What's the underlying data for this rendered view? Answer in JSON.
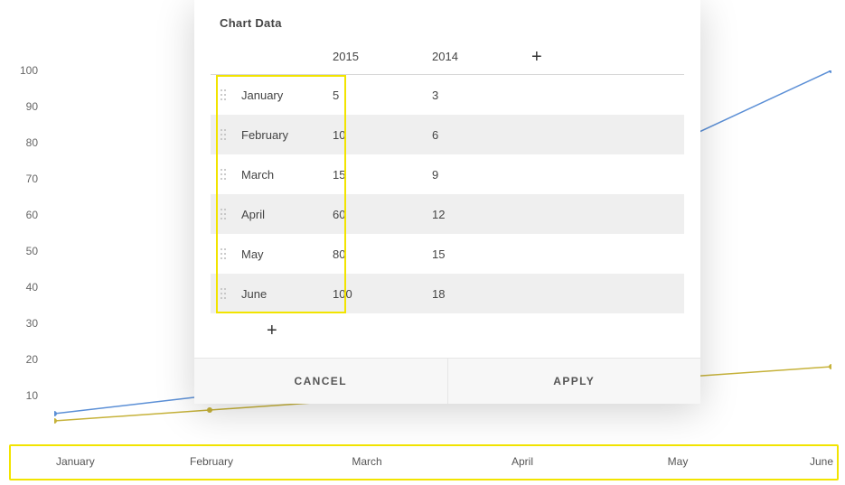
{
  "dialog": {
    "title": "Chart Data",
    "series_headers": [
      "2015",
      "2014"
    ],
    "rows": [
      "January",
      "February",
      "March",
      "April",
      "May",
      "June"
    ],
    "cells": {
      "2015": [
        5,
        10,
        15,
        60,
        80,
        100
      ],
      "2014": [
        3,
        6,
        9,
        12,
        15,
        18
      ]
    },
    "add_series_label": "+",
    "add_row_label": "+",
    "cancel_label": "CANCEL",
    "apply_label": "APPLY"
  },
  "axes": {
    "y_ticks": [
      10,
      20,
      30,
      40,
      50,
      60,
      70,
      80,
      90,
      100
    ],
    "x_ticks": [
      "January",
      "February",
      "March",
      "April",
      "May",
      "June"
    ]
  },
  "chart_data": {
    "type": "line",
    "categories": [
      "January",
      "February",
      "March",
      "April",
      "May",
      "June"
    ],
    "series": [
      {
        "name": "2015",
        "values": [
          5,
          10,
          15,
          60,
          80,
          100
        ],
        "color": "#5b8fd6"
      },
      {
        "name": "2014",
        "values": [
          3,
          6,
          9,
          12,
          15,
          18
        ],
        "color": "#c6b23a"
      }
    ],
    "ylim": [
      0,
      100
    ],
    "xlabel": "",
    "ylabel": "",
    "title": ""
  },
  "colors": {
    "highlight": "#f2e400",
    "series_2015": "#5b8fd6",
    "series_2014": "#c6b23a"
  }
}
